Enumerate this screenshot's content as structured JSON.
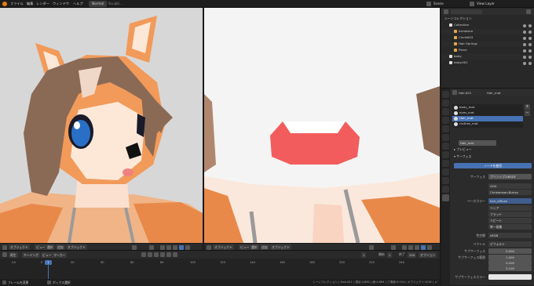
{
  "topbar": {
    "menus": [
      "ファイル",
      "編集",
      "レンダー",
      "ウィンドウ",
      "ヘルプ"
    ],
    "workspaces": [
      {
        "label": "Normal",
        "active": true
      },
      {
        "label": "Sculpti...",
        "active": false
      }
    ],
    "scene": "Scene",
    "view_layer": "View Layer"
  },
  "viewport_left": {
    "header": [
      "オブジェクト",
      "ビュー",
      "選択",
      "追加",
      "オブジェクト"
    ]
  },
  "viewport_right": {
    "header": [
      "オブジェクト",
      "ビュー",
      "選択",
      "追加",
      "オブジェクト"
    ]
  },
  "timeline": {
    "header_left": [
      "再生",
      "キーイング",
      "ビュー",
      "マーカー"
    ],
    "ticks": [
      "-20",
      "0",
      "20",
      "40",
      "60",
      "80",
      "100",
      "120",
      "140",
      "160",
      "180",
      "200",
      "220",
      "240"
    ],
    "current_frame": "1",
    "start_label": "開始",
    "start_value": "1",
    "end_label": "終了",
    "end_value": "250",
    "frame_value": "1",
    "options": "オプション"
  },
  "outliner": {
    "title": "シーンコレクション",
    "items": [
      {
        "label": "Collection",
        "depth": 1
      },
      {
        "label": "Armature",
        "depth": 2
      },
      {
        "label": "Circle003",
        "depth": 2
      },
      {
        "label": "Hair Springs",
        "depth": 2
      },
      {
        "label": "Plane",
        "depth": 2
      },
      {
        "label": "body",
        "depth": 1
      },
      {
        "label": "body.001",
        "depth": 1
      }
    ]
  },
  "properties": {
    "object_name": "Hair.001",
    "material_name": "Hair_mat",
    "slots": [
      "body_mat",
      "eyes_mat",
      "Hair_mat",
      "clothes_mat"
    ],
    "active_slot": 2,
    "current_material": "Hair_mat",
    "preview": "プレビュー",
    "surface": "サーフェス",
    "use_nodes": "ノードを使用",
    "surface_label": "サーフェス",
    "surface_value": "プリンシプルBSDF",
    "ggx": "GGX",
    "subsurface_method": "Christensen-Burley",
    "base_color_label": "ベースカラー",
    "base_color_value": "hair_diffuse",
    "linear": "リニア",
    "flat": "フラット",
    "repeat": "リピート",
    "single_image": "単一画像",
    "color_space_label": "色空間",
    "color_space_value": "sRGB",
    "vector_label": "ベクトル",
    "vector_value": "デフォルト",
    "subsurface_label": "サブサーフェス",
    "subsurface_value": "0.000",
    "subsurface_radius_label": "サブサーフェス範囲",
    "subsurface_radius": [
      "1.000",
      "0.200",
      "0.100"
    ],
    "subsurface_color_label": "サブサーフェスカラー"
  },
  "statusbar": {
    "left": [
      "フレームを変更",
      "ボックス選択"
    ],
    "right": "シーンコレクション | Hair.001 | 頂点:4,682 | 面:4,684 | 三角面:9,154 | オブジェクト:0/16 | メモリ:278.4 MB | 2.83.3"
  },
  "colors": {
    "accent": "#4772b3",
    "panel": "#2b2b2b",
    "viewport_left_bg": "#d9d9d9",
    "viewport_right_bg": "#f3f3f3",
    "fur_orange": "#e8894a",
    "hair_brown": "#8a6a55",
    "eye_blue": "#2a6fc6",
    "mouth_red": "#f25c5c"
  }
}
